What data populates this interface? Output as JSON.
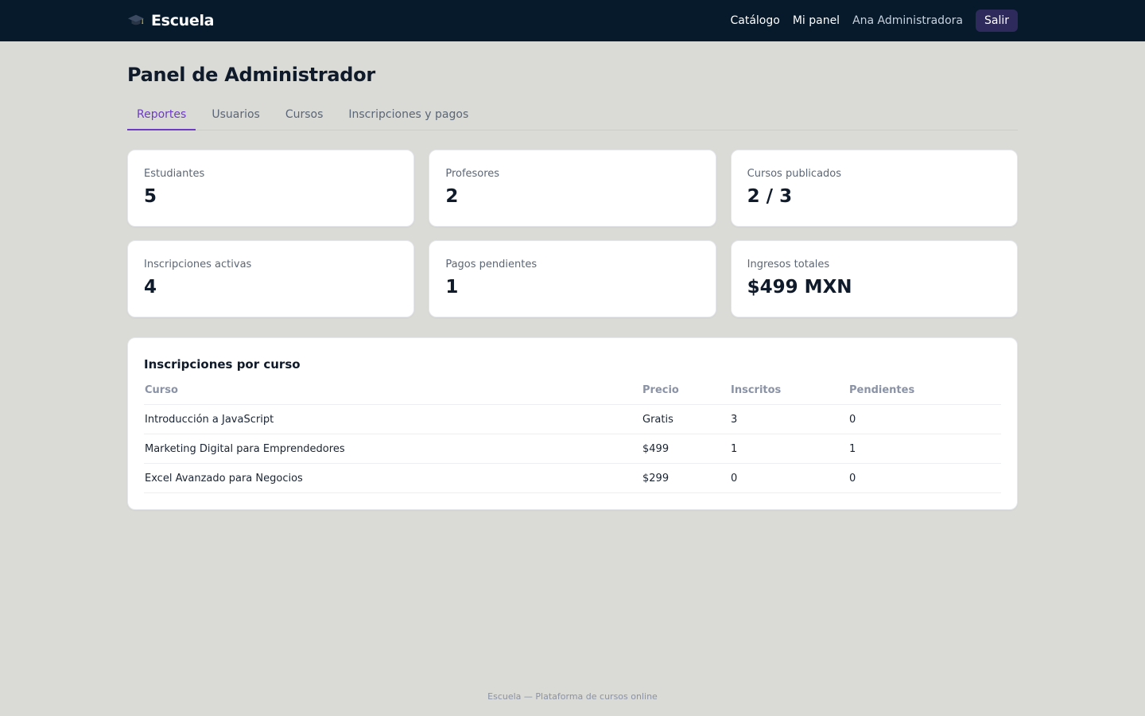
{
  "header": {
    "brand": "Escuela",
    "nav": {
      "catalog": "Catálogo",
      "dashboard": "Mi panel",
      "user": "Ana Administradora",
      "logout": "Salir"
    }
  },
  "page": {
    "title": "Panel de Administrador",
    "tabs": [
      "Reportes",
      "Usuarios",
      "Cursos",
      "Inscripciones y pagos"
    ],
    "active_tab": "Reportes"
  },
  "stats": [
    {
      "label": "Estudiantes",
      "value": "5"
    },
    {
      "label": "Profesores",
      "value": "2"
    },
    {
      "label": "Cursos publicados",
      "value": "2 / 3"
    },
    {
      "label": "Inscripciones activas",
      "value": "4"
    },
    {
      "label": "Pagos pendientes",
      "value": "1"
    },
    {
      "label": "Ingresos totales",
      "value": "$499 MXN"
    }
  ],
  "enrollments": {
    "title": "Inscripciones por curso",
    "columns": [
      "Curso",
      "Precio",
      "Inscritos",
      "Pendientes"
    ],
    "rows": [
      [
        "Introducción a JavaScript",
        "Gratis",
        "3",
        "0"
      ],
      [
        "Marketing Digital para Emprendedores",
        "$499",
        "1",
        "1"
      ],
      [
        "Excel Avanzado para Negocios",
        "$299",
        "0",
        "0"
      ]
    ]
  },
  "footer": "Escuela — Plataforma de cursos online",
  "colors": {
    "topbar": "#061a2c",
    "accent": "#6d3cc2",
    "logout_bg": "#2e2a5c",
    "page_bg": "#dadad6"
  }
}
